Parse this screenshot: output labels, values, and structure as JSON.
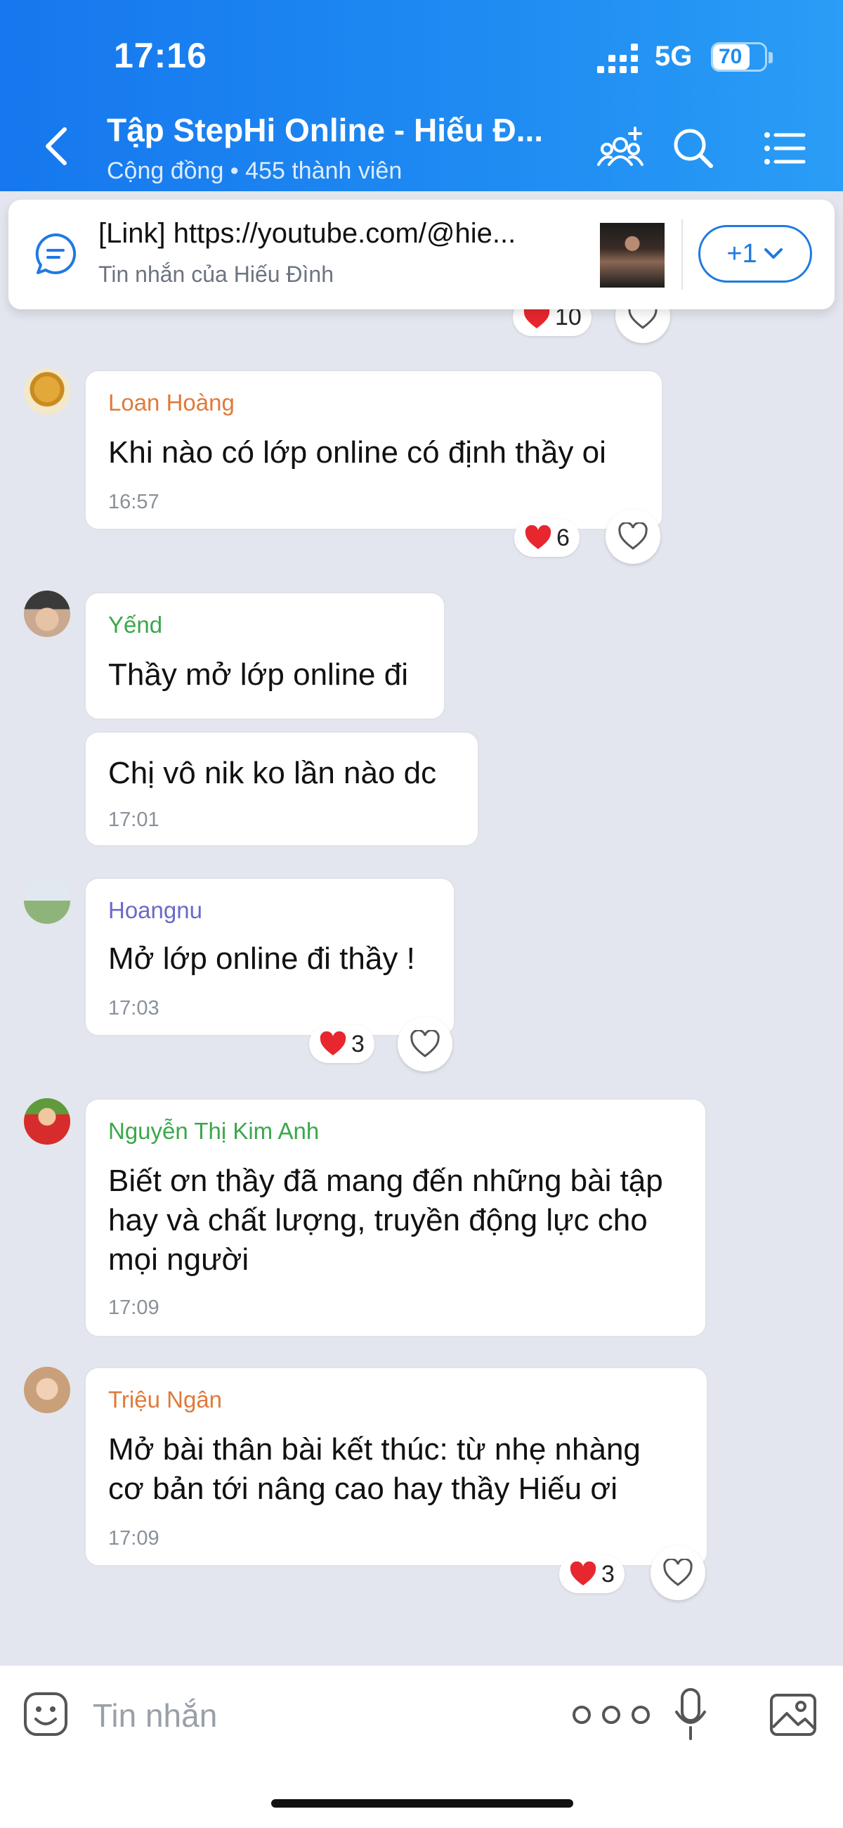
{
  "status_bar": {
    "time": "17:16",
    "network": "5G",
    "battery": "70",
    "battery_level": 0.7
  },
  "header": {
    "title": "Tập StepHi Online - Hiếu Đ...",
    "subtitle": "Cộng đồng • 455 thành viên"
  },
  "icons": {
    "back": "chevron-left-icon",
    "members": "add-member-icon",
    "search": "search-icon",
    "menu": "list-menu-icon"
  },
  "pinned": {
    "text": "[Link] https://youtube.com/@hie...",
    "sub": "Tin nhắn của Hiếu Đình",
    "more": "+1"
  },
  "top_reaction": {
    "count": "10"
  },
  "messages": [
    {
      "sender": "Loan Hoàng",
      "sender_color": "#e07a3a",
      "text": "Khi nào có lớp online có định thầy oi",
      "time": "16:57",
      "reactions": "6"
    },
    {
      "sender": "Yếnd",
      "sender_color": "#3aa84a",
      "text": "Thầy mở lớp online đi"
    },
    {
      "text": "Chị vô nik ko lần nào dc",
      "time": "17:01"
    },
    {
      "sender": "Hoangnu",
      "sender_color": "#6a6ac8",
      "text": "Mở lớp online đi thầy !",
      "time": "17:03",
      "reactions": "3"
    },
    {
      "sender": "Nguyễn Thị Kim Anh",
      "sender_color": "#3aa84a",
      "text": "Biết ơn thầy đã mang đến những bài tập hay và chất lượng, truyền động lực cho mọi người",
      "time": "17:09"
    },
    {
      "sender": "Triệu Ngân",
      "sender_color": "#e07a3a",
      "text": "Mở bài thân bài kết thúc: từ nhẹ nhàng cơ bản tới nâng cao hay thầy Hiếu ơi",
      "time": "17:09",
      "reactions": "3"
    }
  ],
  "input": {
    "placeholder": "Tin nhắn"
  }
}
